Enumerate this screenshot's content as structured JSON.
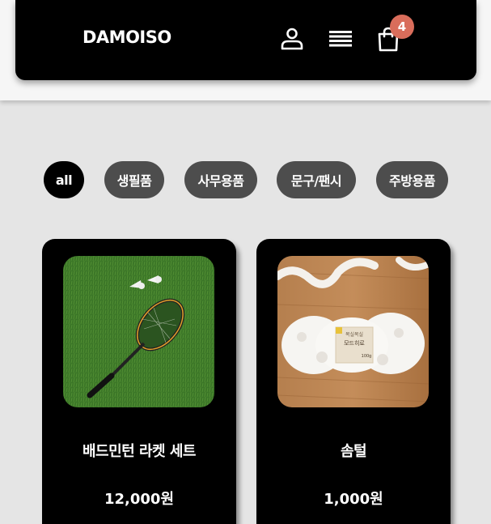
{
  "header": {
    "brand": "DAMOISO",
    "cart_count": "4",
    "icons": [
      "user-icon",
      "menu-icon",
      "shopping-bag-icon"
    ]
  },
  "filters": [
    {
      "label": "all",
      "active": true
    },
    {
      "label": "생필품",
      "active": false
    },
    {
      "label": "사무용품",
      "active": false
    },
    {
      "label": "문구/팬시",
      "active": false
    },
    {
      "label": "주방용품",
      "active": false
    }
  ],
  "products": [
    {
      "name": "배드민턴 라켓 세트",
      "price": "12,000원",
      "image": "badminton-racket-photo"
    },
    {
      "name": "솜털",
      "price": "1,000원",
      "image": "white-yarn-photo"
    }
  ],
  "yarn_label": {
    "line1": "복실복실",
    "line2": "모드히로",
    "weight": "100g"
  },
  "colors": {
    "header_bg": "#000000",
    "chip_bg": "#4d4d4d",
    "chip_active_bg": "#000000",
    "badge": "#d96d5b",
    "page_bg": "#e5e5e5"
  }
}
